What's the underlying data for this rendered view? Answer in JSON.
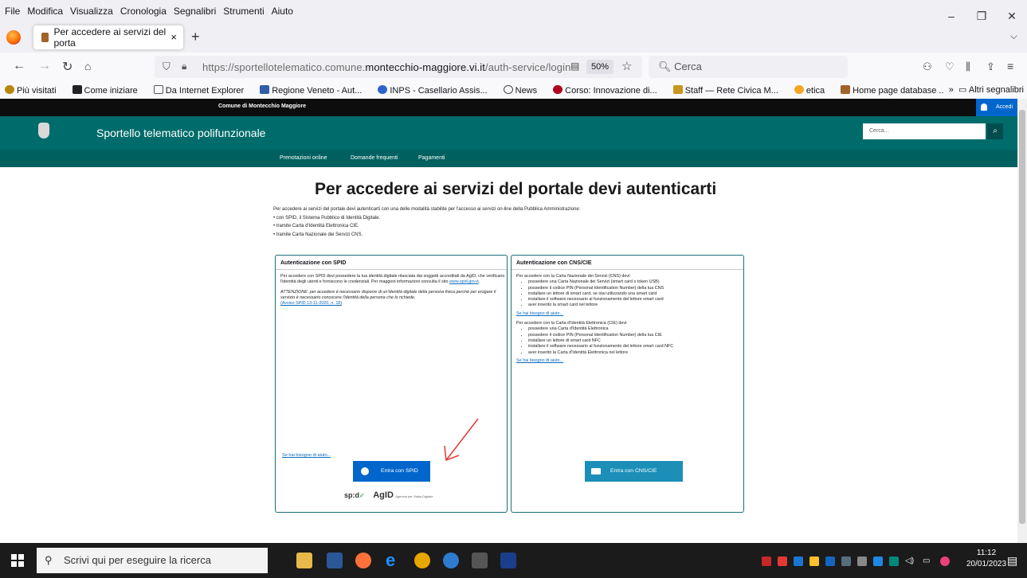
{
  "menu": [
    "File",
    "Modifica",
    "Visualizza",
    "Cronologia",
    "Segnalibri",
    "Strumenti",
    "Aiuto"
  ],
  "tab": {
    "title": "Per accedere ai servizi del porta",
    "close": "×",
    "new": "+"
  },
  "url": {
    "prefix": "https://sportellotelematico.comune.",
    "domain": "montecchio-maggiore.vi.it",
    "path": "/auth-service/login"
  },
  "zoom": "50%",
  "search_placeholder": "Cerca",
  "bookmarks": [
    "Più visitati",
    "Come iniziare",
    "Da Internet Explorer",
    "Regione Veneto - Aut...",
    "INPS - Casellario Assis...",
    "News",
    "Corso: Innovazione di...",
    "Staff — Rete Civica M...",
    "etica",
    "Home page database ..."
  ],
  "other_bookmarks": "Altri segnalibri",
  "site": {
    "municipality": "Comune di Montecchio Maggiore",
    "login": "Accedi",
    "name": "Sportello telematico polifunzionale",
    "search_placeholder": "Cerca...",
    "nav": [
      "Prenotazioni online",
      "Domande frequenti",
      "Pagamenti"
    ]
  },
  "content": {
    "title": "Per accedere ai servizi del portale devi autenticarti",
    "intro": "Per accedere ai servizi del portale devi autenticarti con una delle modalità stabilite per l'accesso ai servizi on-line della Pubblica Amministrazione:",
    "methods": [
      "con SPID, il Sistema Pubblico di Identità Digitale.",
      "tramite Carta d'Identità Elettronica CIE.",
      "tramite Carta Nazionale dei Servizi CNS."
    ],
    "spid": {
      "heading": "Autenticazione con SPID",
      "text": "Per accedere con SPID devi possedere la tua identità digitale rilasciata dai soggetti accreditati da AgID, che verificano l'identità degli utenti e forniscono le credenziali. Per maggiori informazioni consulta il sito",
      "site_link": "www.spid.gov.it",
      "warning": "ATTENZIONE: per accedere è necessario disporre di un'identità digitale della persona fisica perchè per erogare il servizio è necessario conoscere l'identità della persona che lo richiede.",
      "notice_link": "(Avviso SPID 13-11-2020, n. 18)",
      "help": "Se hai bisogno di aiuto...",
      "button": "Entra con SPID",
      "logo_spid": "sp:d",
      "logo_agid": "AgID",
      "logo_agid_sub": "Agenzia per l'Italia Digitale"
    },
    "cns": {
      "heading": "Autenticazione con CNS/CIE",
      "cns_intro": "Per accedere con la Carta Nazionale dei Servizi (CNS) devi:",
      "cns_items": [
        "possedere una Carta Nazionale dei Servizi (smart card o token USB)",
        "possedere il codice PIN (Personal Identification Number) della tua CNS",
        "installare un lettore di smart card, se stai utilizzando una smart card",
        "installare il software necessario al funzionamento del lettore smart card",
        "aver inserito la smart card nel lettore"
      ],
      "help1": "Se hai bisogno di aiuto...",
      "cie_intro": "Per accedere con la Carta d'Identità Elettronica (CIE) devi:",
      "cie_items": [
        "possedere una Carta d'Identità Elettronica",
        "possedere il codice PIN (Personal Identification Number) della tua CIE",
        "installare un lettore di smart card NFC",
        "installare il software necessario al funzionamento del lettore smart card NFC",
        "aver inserito la Carta d'Identità Elettronica nel lettore"
      ],
      "help2": "Se hai bisogno di aiuto...",
      "button": "Entra con CNS/CIE"
    }
  },
  "taskbar": {
    "search": "Scrivi qui per eseguire la ricerca",
    "time": "11:12",
    "date": "20/01/2023"
  },
  "colors": {
    "header": "#006b6b",
    "nav": "#006060",
    "spid_button": "#0066cc",
    "cns_button": "#1b8fb8",
    "arrow": "#e53935"
  }
}
